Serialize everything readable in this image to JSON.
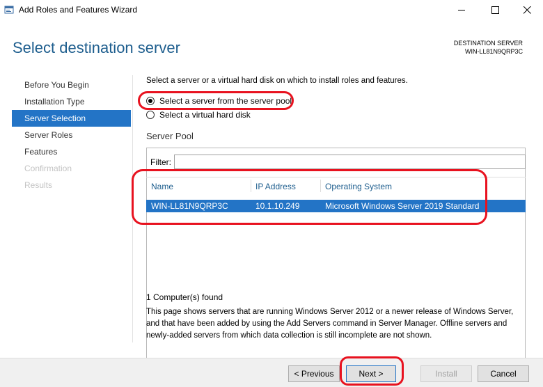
{
  "window": {
    "title": "Add Roles and Features Wizard",
    "icons": [
      "app-icon",
      "minimize-icon",
      "maximize-icon",
      "close-icon"
    ]
  },
  "header": {
    "page_title": "Select destination server",
    "destination_label": "DESTINATION SERVER",
    "destination_value": "WIN-LL81N9QRP3C"
  },
  "nav": {
    "items": [
      {
        "label": "Before You Begin",
        "state": "normal"
      },
      {
        "label": "Installation Type",
        "state": "normal"
      },
      {
        "label": "Server Selection",
        "state": "active"
      },
      {
        "label": "Server Roles",
        "state": "normal"
      },
      {
        "label": "Features",
        "state": "normal"
      },
      {
        "label": "Confirmation",
        "state": "disabled"
      },
      {
        "label": "Results",
        "state": "disabled"
      }
    ]
  },
  "content": {
    "instruction": "Select a server or a virtual hard disk on which to install roles and features.",
    "radio_pool": "Select a server from the server pool",
    "radio_vhd": "Select a virtual hard disk",
    "section_title": "Server Pool",
    "filter_label": "Filter:",
    "filter_value": "",
    "columns": [
      "Name",
      "IP Address",
      "Operating System"
    ],
    "rows": [
      {
        "name": "WIN-LL81N9QRP3C",
        "ip": "10.1.10.249",
        "os": "Microsoft Windows Server 2019 Standard"
      }
    ],
    "count_text": "1 Computer(s) found",
    "info_text": "This page shows servers that are running Windows Server 2012 or a newer release of Windows Server, and that have been added by using the Add Servers command in Server Manager. Offline servers and newly-added servers from which data collection is still incomplete are not shown."
  },
  "buttons": {
    "previous": "< Previous",
    "next": "Next >",
    "install": "Install",
    "cancel": "Cancel"
  },
  "colors": {
    "accent": "#2374c6",
    "title_blue": "#1e5e8e",
    "annotation_red": "#e8121f"
  }
}
